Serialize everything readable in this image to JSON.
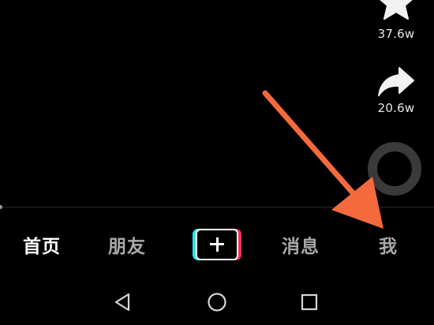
{
  "actions": {
    "like": {
      "icon": "star-icon",
      "count": "37.6w"
    },
    "share": {
      "icon": "share-arrow-icon",
      "count": "20.6w"
    },
    "music": {
      "icon": "music-disc-icon"
    }
  },
  "video": {
    "progress_fraction": 0.0
  },
  "bottom_nav": {
    "tabs": [
      {
        "label": "首页",
        "active": true
      },
      {
        "label": "朋友",
        "active": false
      },
      {
        "label": "消息",
        "active": false
      },
      {
        "label": "我",
        "active": false
      }
    ],
    "create_icon": "plus-icon"
  },
  "system_nav": {
    "back_icon": "triangle-back-icon",
    "home_icon": "circle-home-icon",
    "recents_icon": "square-recents-icon"
  },
  "colors": {
    "background": "#000000",
    "active_tab": "#ffffff",
    "inactive_tab": "#a9a9a9",
    "create_cyan": "#27e6ea",
    "create_pink": "#f2335a",
    "annotation": "#f46a3d"
  }
}
